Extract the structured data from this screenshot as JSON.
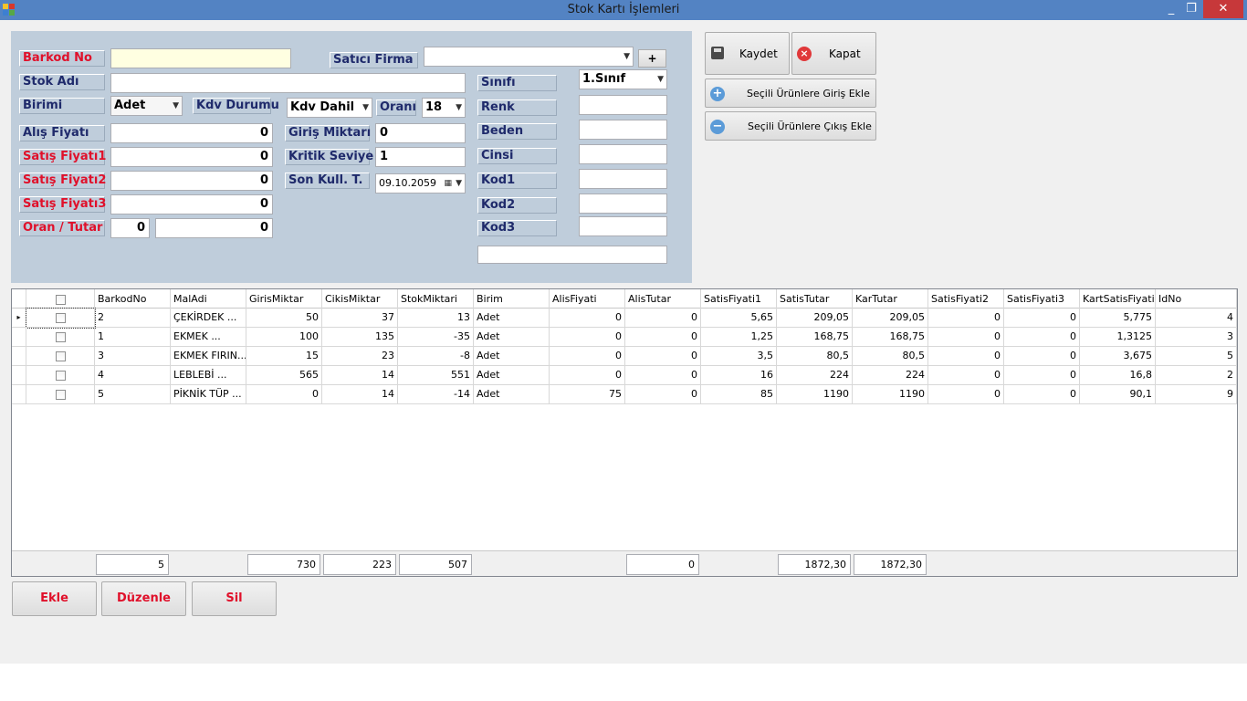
{
  "window": {
    "title": "Stok Kartı İşlemleri",
    "minimize": "_",
    "maximize": "❐",
    "close": "✕"
  },
  "form": {
    "barkod_label": "Barkod No",
    "barkod_value": "",
    "satici_label": "Satıcı Firma",
    "satici_value": "",
    "plus_label": "+",
    "stokadi_label": "Stok Adı",
    "stokadi_value": "",
    "birimi_label": "Birimi",
    "birimi_value": "Adet",
    "kdv_label": "Kdv Durumu",
    "kdv_value": "Kdv Dahil",
    "orani_label": "Oranı",
    "orani_value": "18",
    "alis_label": "Alış Fiyatı",
    "alis_value": "0",
    "satis1_label": "Satış Fiyatı1",
    "satis1_value": "0",
    "satis2_label": "Satış Fiyatı2",
    "satis2_value": "0",
    "satis3_label": "Satış Fiyatı3",
    "satis3_value": "0",
    "oran_tutar_label": "Oran / Tutar",
    "oran_value": "0",
    "tutar_value": "0",
    "giris_label": "Giriş Miktarı",
    "giris_value": "0",
    "kritik_label": "Kritik Seviye",
    "kritik_value": "1",
    "sonkull_label": "Son Kull. T.",
    "sonkull_value": "09.10.2059",
    "sinifi_label": "Sınıfı",
    "sinifi_value": "1.Sınıf",
    "renk_label": "Renk",
    "beden_label": "Beden",
    "cinsi_label": "Cinsi",
    "kod1_label": "Kod1",
    "kod2_label": "Kod2",
    "kod3_label": "Kod3"
  },
  "buttons": {
    "kaydet": "Kaydet",
    "kapat": "Kapat",
    "giris_ekle": "Seçili Ürünlere Giriş Ekle",
    "cikis_ekle": "Seçili Ürünlere Çıkış Ekle",
    "ekle": "Ekle",
    "duzenle": "Düzenle",
    "sil": "Sil"
  },
  "grid": {
    "columns": [
      "BarkodNo",
      "MalAdi",
      "GirisMiktar",
      "CikisMiktar",
      "StokMiktari",
      "Birim",
      "AlisFiyati",
      "AlisTutar",
      "SatisFiyati1",
      "SatisTutar",
      "KarTutar",
      "SatisFiyati2",
      "SatisFiyati3",
      "KartSatisFiyati",
      "IdNo"
    ],
    "row_marker": "▸",
    "rows": [
      [
        "2",
        "ÇEKİRDEK    ...",
        "50",
        "37",
        "13",
        "Adet",
        "0",
        "0",
        "5,65",
        "209,05",
        "209,05",
        "0",
        "0",
        "5,775",
        "4"
      ],
      [
        "1",
        "EKMEK       ...",
        "100",
        "135",
        "-35",
        "Adet",
        "0",
        "0",
        "1,25",
        "168,75",
        "168,75",
        "0",
        "0",
        "1,3125",
        "3"
      ],
      [
        "3",
        "EKMEK FIRIN...",
        "15",
        "23",
        "-8",
        "Adet",
        "0",
        "0",
        "3,5",
        "80,5",
        "80,5",
        "0",
        "0",
        "3,675",
        "5"
      ],
      [
        "4",
        "LEBLEBİ     ...",
        "565",
        "14",
        "551",
        "Adet",
        "0",
        "0",
        "16",
        "224",
        "224",
        "0",
        "0",
        "16,8",
        "2"
      ],
      [
        "5",
        "PİKNİK TÜP  ...",
        "0",
        "14",
        "-14",
        "Adet",
        "75",
        "0",
        "85",
        "1190",
        "1190",
        "0",
        "0",
        "90,1",
        "9"
      ]
    ],
    "totals": {
      "count": "5",
      "giris": "730",
      "cikis": "223",
      "stok": "507",
      "alis_tutar": "0",
      "satis_tutar": "1872,30",
      "kar_tutar": "1872,30"
    }
  },
  "colors": {
    "titlebar": "#5383c3",
    "panel": "#bfcddb",
    "label_red": "#e0102a",
    "label_navy": "#1f2a6b",
    "close": "#c7383a"
  }
}
